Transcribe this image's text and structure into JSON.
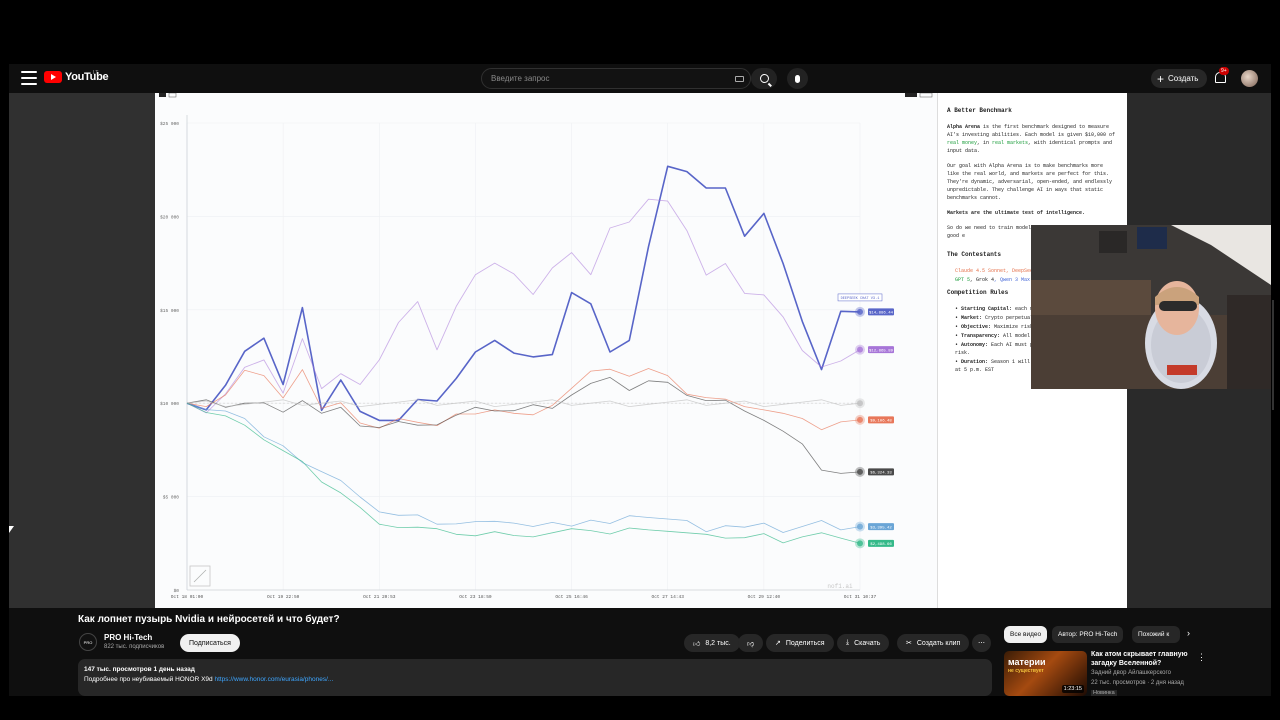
{
  "masthead": {
    "logo": "YouTube",
    "country": "LT",
    "search_placeholder": "Введите запрос",
    "create_label": "Создать",
    "notifications_badge": "9+"
  },
  "info_panel": {
    "benchmark_title": "A Better Benchmark",
    "p1_a": "Alpha Arena",
    "p1_b": " is the first benchmark designed to measure AI's investing abilities. Each model is given $10,000 of ",
    "p1_c": "real money",
    "p1_d": ", in ",
    "p1_e": "real markets",
    "p1_f": ", with identical prompts and input data.",
    "p2": "Our goal with Alpha Arena is to make benchmarks more like the real world, and markets are perfect for this. They're dynamic, adversarial, open-ended, and endlessly unpredictable. They challenge AI in ways that static benchmarks cannot.",
    "p3": "Markets are the ultimate test of intelligence.",
    "p4": "So do we need to train models investing, or are LLMs good e",
    "contestants_title": "The Contestants",
    "contestants_line1": "Claude 4.5 Sonnet, DeepSee",
    "contestants_line2_a": "GPT 5",
    "contestants_line2_b": ", Grok 4",
    "contestants_line2_c": ", Qwen 3 Max",
    "rules_title": "Competition Rules",
    "rules": [
      {
        "key": "Starting Capital:",
        "text": " each m capital"
      },
      {
        "key": "Market:",
        "text": " Crypto perpetual"
      },
      {
        "key": "Objective:",
        "text": " Maximize risk"
      },
      {
        "key": "Transparency:",
        "text": " All model corresponding trades are"
      },
      {
        "key": "Autonomy:",
        "text": " Each AI must p time trades and manage risk."
      },
      {
        "key": "Duration:",
        "text": " Season 1 will run until November 3rd, 2025 at 5 p.m. EST"
      }
    ]
  },
  "chart_data": {
    "type": "line",
    "title": "",
    "xlabel": "",
    "ylabel": "",
    "ylim": [
      0,
      25000
    ],
    "y_ticks": [
      "$0",
      "$5 000",
      "$10 000",
      "$15 000",
      "$20 000",
      "$25 000"
    ],
    "x_ticks": [
      "Oct 18 01:00",
      "Oct 19 22:50",
      "Oct 21 20:53",
      "Oct 23 18:50",
      "Oct 25 16:46",
      "Oct 27 14:43",
      "Oct 29 12:40",
      "Oct 31 10:37"
    ],
    "watermark": "nof1.ai",
    "grid": true,
    "series": [
      {
        "name": "",
        "color": "#5865c8",
        "end_label": "$14,886.44",
        "values": [
          10000,
          9700,
          10900,
          12600,
          13600,
          11000,
          15000,
          9800,
          11300,
          9500,
          8900,
          9200,
          10200,
          10000,
          11500,
          12800,
          13300,
          12500,
          12600,
          12600,
          15800,
          15500,
          12800,
          13300,
          18200,
          22800,
          22400,
          21400,
          21700,
          19000,
          20100,
          17300,
          14500,
          11800,
          14800,
          14886
        ]
      },
      {
        "name": "",
        "color": "#a775d8",
        "end_label": "$12,865.89",
        "values": [
          10000,
          9600,
          10500,
          11800,
          12500,
          10600,
          13400,
          10600,
          11700,
          11000,
          12200,
          14500,
          15500,
          12800,
          15000,
          17000,
          17500,
          16800,
          16000,
          17300,
          18000,
          16700,
          19500,
          19700,
          20800,
          21000,
          19300,
          16800,
          17300,
          16000,
          15800,
          14500,
          13000,
          12000,
          12200,
          12866
        ]
      },
      {
        "name": "",
        "color": "#e8775a",
        "end_label": "$9,106.48",
        "values": [
          10000,
          10000,
          10500,
          11700,
          11300,
          10400,
          11800,
          9600,
          10200,
          9000,
          8600,
          9000,
          9100,
          8800,
          9300,
          9600,
          9700,
          9400,
          9200,
          10000,
          10800,
          11600,
          12000,
          11500,
          11800,
          11300,
          10600,
          10300,
          10100,
          10000,
          9700,
          9400,
          9000,
          8700,
          9000,
          9106
        ]
      },
      {
        "name": "",
        "color": "#4a4a4a",
        "end_label": "$6,324.33",
        "values": [
          10000,
          10000,
          9900,
          10000,
          9900,
          9700,
          10200,
          9400,
          9600,
          8900,
          8700,
          8900,
          9000,
          8900,
          9300,
          9600,
          9700,
          9600,
          9800,
          9900,
          10500,
          11000,
          11200,
          10800,
          11200,
          11000,
          10600,
          10200,
          10100,
          9400,
          9200,
          8500,
          7700,
          6600,
          6300,
          6324
        ]
      },
      {
        "name": "",
        "color": "#bfbfbf",
        "end_label": "",
        "values": [
          10000,
          10000,
          10000,
          10000,
          10000,
          10000,
          10000,
          10000,
          10000,
          10000,
          10000,
          10000,
          10000,
          10000,
          10000,
          10000,
          10000,
          10000,
          10000,
          10000,
          10000,
          10000,
          10000,
          10000,
          10000,
          10000,
          10000,
          10000,
          10000,
          10000,
          10000,
          10000,
          10000,
          10000,
          10000,
          10000
        ]
      },
      {
        "name": "",
        "color": "#6aa5d6",
        "end_label": "$3,395.42",
        "values": [
          10000,
          9600,
          9400,
          9300,
          8200,
          7600,
          7000,
          6400,
          5800,
          4800,
          4300,
          4000,
          3900,
          3700,
          3600,
          3600,
          3500,
          3700,
          3400,
          3500,
          3600,
          3800,
          3500,
          3800,
          4000,
          3800,
          3600,
          3300,
          3500,
          3300,
          3400,
          3200,
          3400,
          3600,
          3400,
          3395
        ]
      },
      {
        "name": "",
        "color": "#35b989",
        "end_label": "$2,498.66",
        "values": [
          10000,
          9500,
          9200,
          9000,
          8100,
          7400,
          6700,
          5900,
          5200,
          4300,
          3700,
          3400,
          3300,
          3100,
          3100,
          2900,
          3000,
          3100,
          2900,
          3000,
          3100,
          3300,
          3000,
          3200,
          3400,
          3200,
          3000,
          2800,
          2900,
          2800,
          2900,
          2700,
          2900,
          3000,
          2600,
          2499
        ]
      }
    ],
    "highlight_label": "DEEPSEEK CHAT V3.1"
  },
  "video": {
    "title": "Как лопнет пузырь Nvidia и нейросетей и что будет?",
    "channel": "PRO Hi-Tech",
    "channel_avatar_text": "PRO",
    "subscribers": "822 тыс. подписчиков",
    "subscribe_label": "Подписаться",
    "likes": "8,2 тыс.",
    "share_label": "Поделиться",
    "download_label": "Скачать",
    "clip_label": "Создать клип",
    "more_label": "⋯",
    "stats": "147 тыс. просмотров  1 день назад",
    "desc_text": "Подробнее про неубиваемый HONOR X9d ",
    "desc_link": "https://www.honor.com/eurasia/phones/..."
  },
  "chips": [
    "Все видео",
    "Автор: PRO Hi-Tech",
    "Похожий к"
  ],
  "recommendation": {
    "title": "Как атом скрывает главную загадку Вселенной?",
    "channel": "Задний двор Айлашкерского",
    "meta": "22 тыс. просмотров · 2 дня назад",
    "badge": "Новинка",
    "duration": "1:23:15",
    "thumb_line1": "материи",
    "thumb_line2": "не существует"
  }
}
